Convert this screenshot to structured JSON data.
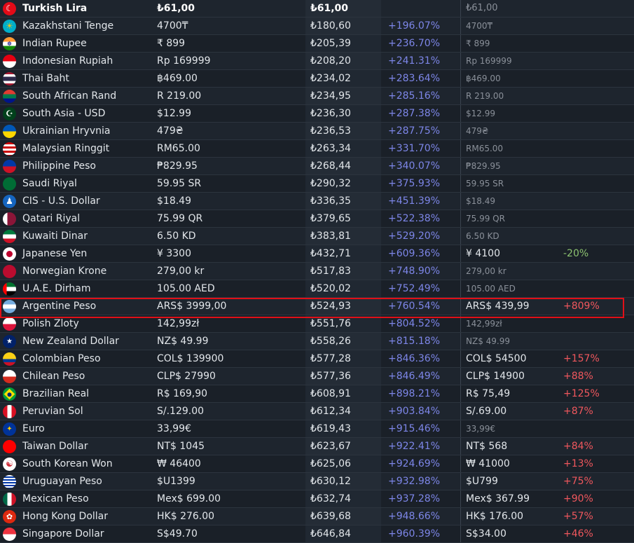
{
  "header": {
    "name": "Turkish Lira",
    "price": "₺61,00",
    "try_price": "₺61,00",
    "old_price": "₺61,00"
  },
  "rows": [
    {
      "flag": "kz",
      "name": "Kazakhstani Tenge",
      "price": "4700₸",
      "try": "₺180,60",
      "pct": "+196.07%",
      "old": "4700₸",
      "diff": ""
    },
    {
      "flag": "in",
      "name": "Indian Rupee",
      "price": "₹ 899",
      "try": "₺205,39",
      "pct": "+236.70%",
      "old": "₹ 899",
      "diff": ""
    },
    {
      "flag": "id",
      "name": "Indonesian Rupiah",
      "price": "Rp 169999",
      "try": "₺208,20",
      "pct": "+241.31%",
      "old": "Rp 169999",
      "diff": ""
    },
    {
      "flag": "th",
      "name": "Thai Baht",
      "price": "฿469.00",
      "try": "₺234,02",
      "pct": "+283.64%",
      "old": "฿469.00",
      "diff": ""
    },
    {
      "flag": "za",
      "name": "South African Rand",
      "price": "R 219.00",
      "try": "₺234,95",
      "pct": "+285.16%",
      "old": "R 219.00",
      "diff": ""
    },
    {
      "flag": "pk",
      "name": "South Asia - USD",
      "price": "$12.99",
      "try": "₺236,30",
      "pct": "+287.38%",
      "old": "$12.99",
      "diff": ""
    },
    {
      "flag": "ua",
      "name": "Ukrainian Hryvnia",
      "price": "479₴",
      "try": "₺236,53",
      "pct": "+287.75%",
      "old": "479₴",
      "diff": ""
    },
    {
      "flag": "my",
      "name": "Malaysian Ringgit",
      "price": "RM65.00",
      "try": "₺263,34",
      "pct": "+331.70%",
      "old": "RM65.00",
      "diff": ""
    },
    {
      "flag": "ph",
      "name": "Philippine Peso",
      "price": "₱829.95",
      "try": "₺268,44",
      "pct": "+340.07%",
      "old": "₱829.95",
      "diff": ""
    },
    {
      "flag": "sa",
      "name": "Saudi Riyal",
      "price": "59.95 SR",
      "try": "₺290,32",
      "pct": "+375.93%",
      "old": "59.95 SR",
      "diff": ""
    },
    {
      "flag": "cis",
      "name": "CIS - U.S. Dollar",
      "price": "$18.49",
      "try": "₺336,35",
      "pct": "+451.39%",
      "old": "$18.49",
      "diff": ""
    },
    {
      "flag": "qa",
      "name": "Qatari Riyal",
      "price": "75.99 QR",
      "try": "₺379,65",
      "pct": "+522.38%",
      "old": "75.99 QR",
      "diff": ""
    },
    {
      "flag": "kw",
      "name": "Kuwaiti Dinar",
      "price": "6.50 KD",
      "try": "₺383,81",
      "pct": "+529.20%",
      "old": "6.50 KD",
      "diff": ""
    },
    {
      "flag": "jp",
      "name": "Japanese Yen",
      "price": "¥ 3300",
      "try": "₺432,71",
      "pct": "+609.36%",
      "old": "¥ 4100",
      "old_full": true,
      "diff": "-20%",
      "diff_type": "neg"
    },
    {
      "flag": "no",
      "name": "Norwegian Krone",
      "price": "279,00 kr",
      "try": "₺517,83",
      "pct": "+748.90%",
      "old": "279,00 kr",
      "diff": ""
    },
    {
      "flag": "ae",
      "name": "U.A.E. Dirham",
      "price": "105.00 AED",
      "try": "₺520,02",
      "pct": "+752.49%",
      "old": "105.00 AED",
      "diff": ""
    },
    {
      "flag": "ar",
      "name": "Argentine Peso",
      "price": "ARS$ 3999,00",
      "try": "₺524,93",
      "pct": "+760.54%",
      "old": "ARS$ 439,99",
      "old_full": true,
      "diff": "+809%",
      "diff_type": "pos"
    },
    {
      "flag": "pl",
      "name": "Polish Zloty",
      "price": "142,99zł",
      "try": "₺551,76",
      "pct": "+804.52%",
      "old": "142,99zł",
      "diff": ""
    },
    {
      "flag": "nz",
      "name": "New Zealand Dollar",
      "price": "NZ$ 49.99",
      "try": "₺558,26",
      "pct": "+815.18%",
      "old": "NZ$ 49.99",
      "diff": ""
    },
    {
      "flag": "co",
      "name": "Colombian Peso",
      "price": "COL$ 139900",
      "try": "₺577,28",
      "pct": "+846.36%",
      "old": "COL$ 54500",
      "old_full": true,
      "diff": "+157%",
      "diff_type": "pos"
    },
    {
      "flag": "cl",
      "name": "Chilean Peso",
      "price": "CLP$ 27990",
      "try": "₺577,36",
      "pct": "+846.49%",
      "old": "CLP$ 14900",
      "old_full": true,
      "diff": "+88%",
      "diff_type": "pos"
    },
    {
      "flag": "br",
      "name": "Brazilian Real",
      "price": "R$ 169,90",
      "try": "₺608,91",
      "pct": "+898.21%",
      "old": "R$ 75,49",
      "old_full": true,
      "diff": "+125%",
      "diff_type": "pos"
    },
    {
      "flag": "pe",
      "name": "Peruvian Sol",
      "price": "S/.129.00",
      "try": "₺612,34",
      "pct": "+903.84%",
      "old": "S/.69.00",
      "old_full": true,
      "diff": "+87%",
      "diff_type": "pos"
    },
    {
      "flag": "eu",
      "name": "Euro",
      "price": "33,99€",
      "try": "₺619,43",
      "pct": "+915.46%",
      "old": "33,99€",
      "diff": ""
    },
    {
      "flag": "tw",
      "name": "Taiwan Dollar",
      "price": "NT$ 1045",
      "try": "₺623,67",
      "pct": "+922.41%",
      "old": "NT$ 568",
      "old_full": true,
      "diff": "+84%",
      "diff_type": "pos"
    },
    {
      "flag": "kr",
      "name": "South Korean Won",
      "price": "₩ 46400",
      "try": "₺625,06",
      "pct": "+924.69%",
      "old": "₩ 41000",
      "old_full": true,
      "diff": "+13%",
      "diff_type": "pos"
    },
    {
      "flag": "uy",
      "name": "Uruguayan Peso",
      "price": "$U1399",
      "try": "₺630,12",
      "pct": "+932.98%",
      "old": "$U799",
      "old_full": true,
      "diff": "+75%",
      "diff_type": "pos"
    },
    {
      "flag": "mx",
      "name": "Mexican Peso",
      "price": "Mex$ 699.00",
      "try": "₺632,74",
      "pct": "+937.28%",
      "old": "Mex$ 367.99",
      "old_full": true,
      "diff": "+90%",
      "diff_type": "pos"
    },
    {
      "flag": "hk",
      "name": "Hong Kong Dollar",
      "price": "HK$ 276.00",
      "try": "₺639,68",
      "pct": "+948.66%",
      "old": "HK$ 176.00",
      "old_full": true,
      "diff": "+57%",
      "diff_type": "pos"
    },
    {
      "flag": "sg",
      "name": "Singapore Dollar",
      "price": "S$49.70",
      "try": "₺646,84",
      "pct": "+960.39%",
      "old": "S$34.00",
      "old_full": true,
      "diff": "+46%",
      "diff_type": "pos"
    }
  ],
  "highlighted_row": "Argentine Peso",
  "colors": {
    "percent": "#7d86e8",
    "increase": "#f0575d",
    "decrease": "#8cc270",
    "highlight_border": "#e01018"
  },
  "flag_icons": {
    "tr": "☾",
    "kz": "☀",
    "in": "☸",
    "sa": "﷽",
    "pk": "☪",
    "cis": "♟",
    "nz": "★",
    "eu": "✦",
    "kr": "☯",
    "hk": "✿"
  }
}
